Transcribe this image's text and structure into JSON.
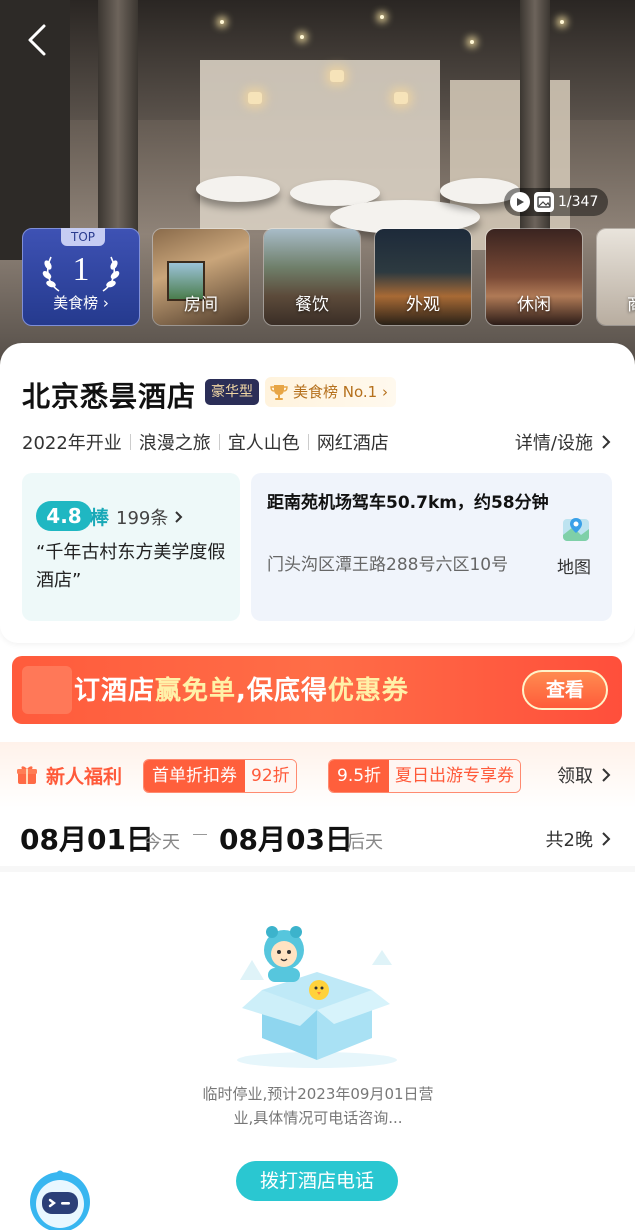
{
  "hero": {
    "media_count": "1/347",
    "rank": {
      "top_tag": "TOP",
      "number": "1",
      "label": "美食榜 ›"
    },
    "thumbnails": [
      {
        "label": "房间"
      },
      {
        "label": "餐饮"
      },
      {
        "label": "外观"
      },
      {
        "label": "休闲"
      },
      {
        "label": "商"
      }
    ]
  },
  "hotel": {
    "name": "北京悉昙酒店",
    "level_badge": "豪华型",
    "rank_badge": "美食榜 No.1 ›",
    "tags": [
      "2022年开业",
      "浪漫之旅",
      "宜人山色",
      "网红酒店"
    ],
    "details_link": "详情/设施"
  },
  "rating": {
    "score": "4.8",
    "word": "棒",
    "reviews": "199条",
    "quote": "“千年古村东方美学度假酒店”"
  },
  "location": {
    "distance": "距南苑机场驾车50.7km，约58分钟",
    "address": "门头沟区潭王路288号六区10号",
    "map_label": "地图"
  },
  "promo": {
    "text_a": "订酒店",
    "text_b": "赢免单",
    "text_c": ",保底得",
    "text_d": "优惠券",
    "button": "查看"
  },
  "new_user": {
    "title": "新人福利",
    "coupons": [
      {
        "name": "首单折扣券",
        "value": "92折"
      },
      {
        "name": "9.5折",
        "value": "夏日出游专享券"
      }
    ],
    "claim": "领取"
  },
  "dates": {
    "checkin": "08月01日",
    "checkin_day": "今天",
    "checkout": "08月03日",
    "checkout_day": "后天",
    "nights": "共2晚"
  },
  "empty_state": {
    "notice": "临时停业,预计2023年09月01日营业,具体情况可电话咨询...",
    "call_button": "拨打酒店电话"
  },
  "colors": {
    "accent_teal": "#2ac7d1",
    "promo_red": "#ff5b3c",
    "rank_blue": "#2f45a0"
  }
}
